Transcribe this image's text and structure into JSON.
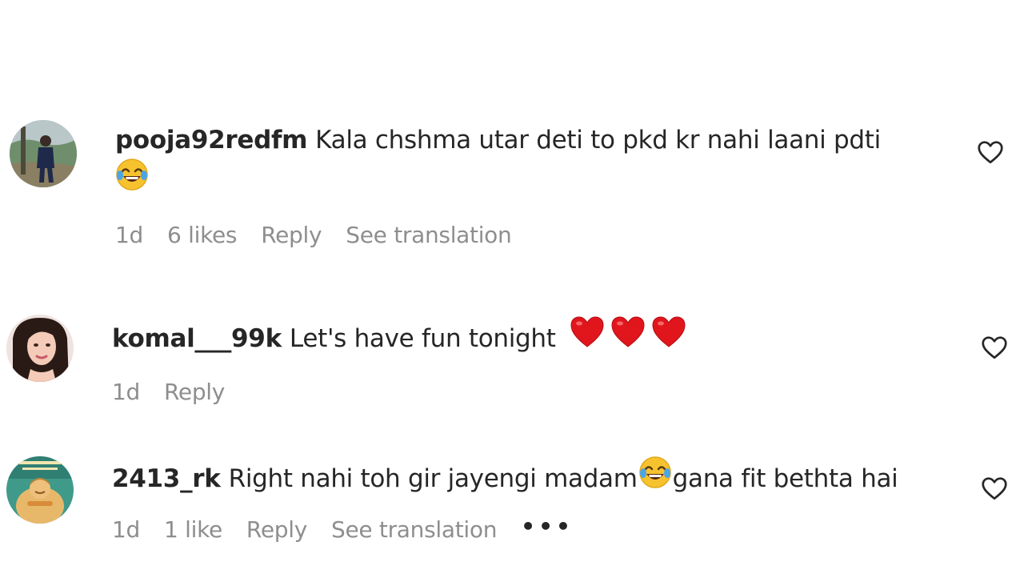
{
  "comments": [
    {
      "username": "pooja92redfm",
      "text": "Kala chshma utar deti to pkd kr nahi laani pdti",
      "emoji": "joy-emoji",
      "time": "1d",
      "likes": "6 likes",
      "reply": "Reply",
      "translation": "See translation"
    },
    {
      "username": "komal___99k",
      "text": "Let's have fun tonight",
      "emoji": "red-heart-emoji",
      "time": "1d",
      "reply": "Reply"
    },
    {
      "username": "2413_rk",
      "text_before": "Right nahi toh gir jayengi madam",
      "text_after": "gana fit bethta hai",
      "emoji": "joy-emoji",
      "time": "1d",
      "likes": "1 like",
      "reply": "Reply",
      "translation": "See translation",
      "more": "•••"
    }
  ],
  "colors": {
    "text": "#262626",
    "secondary": "#8e8e8e",
    "heart_emoji": "#e0161c",
    "background": "#ffffff"
  },
  "icons": {
    "like": "heart-outline-icon",
    "more": "more-options-icon"
  }
}
